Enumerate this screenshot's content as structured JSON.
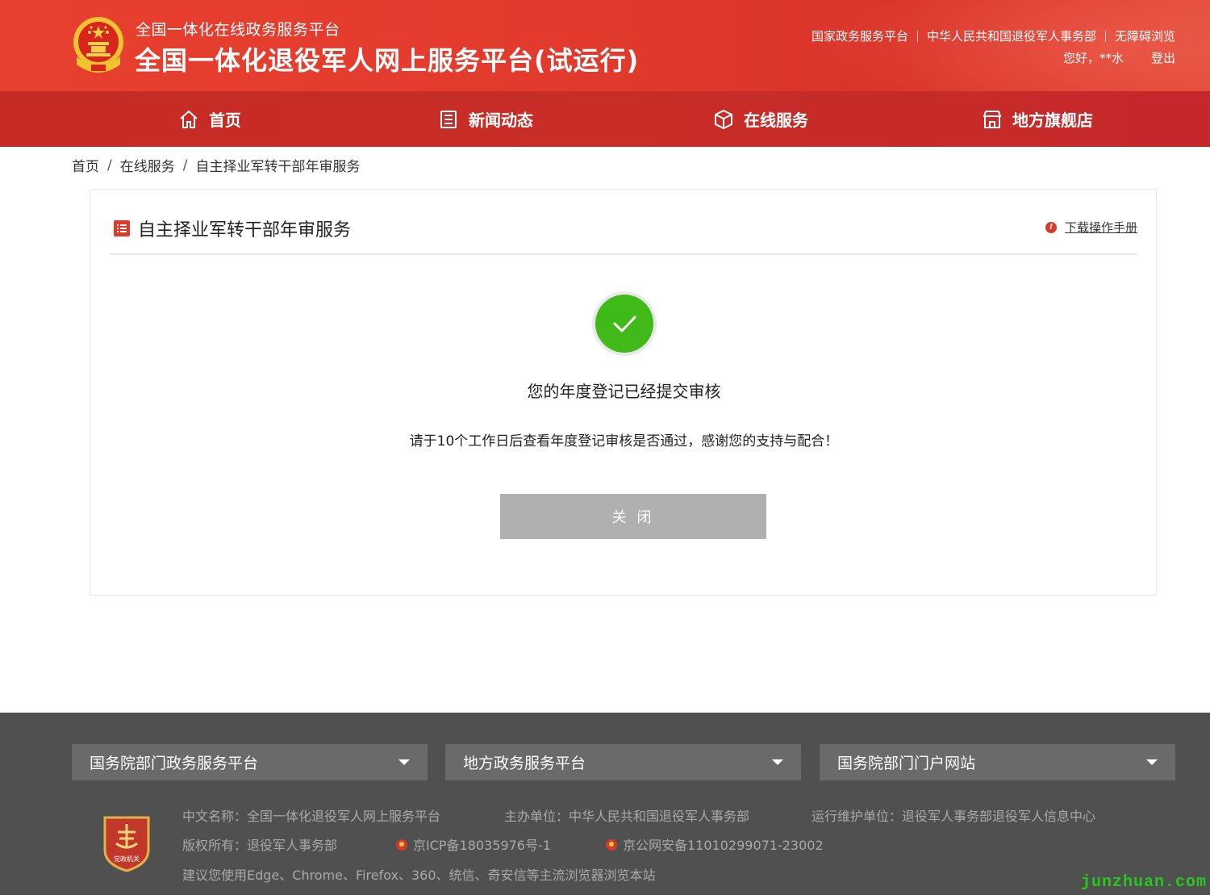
{
  "header": {
    "subtitle": "全国一体化在线政务服务平台",
    "title": "全国一体化退役军人网上服务平台(试运行)",
    "links": [
      "国家政务服务平台",
      "中华人民共和国退役军人事务部",
      "无障碍浏览"
    ],
    "greeting": "您好，**水",
    "logout": "登出",
    "emblem_icon": "national-emblem"
  },
  "nav": {
    "items": [
      {
        "label": "首页",
        "icon": "home-icon"
      },
      {
        "label": "新闻动态",
        "icon": "news-icon"
      },
      {
        "label": "在线服务",
        "icon": "service-icon"
      },
      {
        "label": "地方旗舰店",
        "icon": "store-icon"
      }
    ]
  },
  "breadcrumb": [
    "首页",
    "在线服务",
    "自主择业军转干部年审服务"
  ],
  "card": {
    "title": "自主择业军转干部年审服务",
    "manual_link": "下载操作手册",
    "success_title": "您的年度登记已经提交审核",
    "success_desc": "请于10个工作日后查看年度登记审核是否通过，感谢您的支持与配合！",
    "close_button": "关 闭"
  },
  "footer": {
    "selects": [
      "国务院部门政务服务平台",
      "地方政务服务平台",
      "国务院部门门户网站"
    ],
    "chinese_name": "中文名称：全国一体化退役军人网上服务平台",
    "sponsor": "主办单位：中华人民共和国退役军人事务部",
    "maintainer": "运行维护单位：退役军人事务部退役军人信息中心",
    "copyright": "版权所有：退役军人事务部",
    "icp": "京ICP备18035976号-1",
    "police": "京公网安备11010299071-23002",
    "browser_tip": "建议您使用Edge、Chrome、Firefox、360、统信、奇安信等主流浏览器浏览本站",
    "badge_text": "党政机关"
  },
  "watermark": "junzhuan.com",
  "colors": {
    "header_red": "#e23b2d",
    "nav_red": "#c62a24",
    "success_green": "#3fba19",
    "button_gray": "#b0b0b0",
    "footer_bg": "#505050"
  }
}
